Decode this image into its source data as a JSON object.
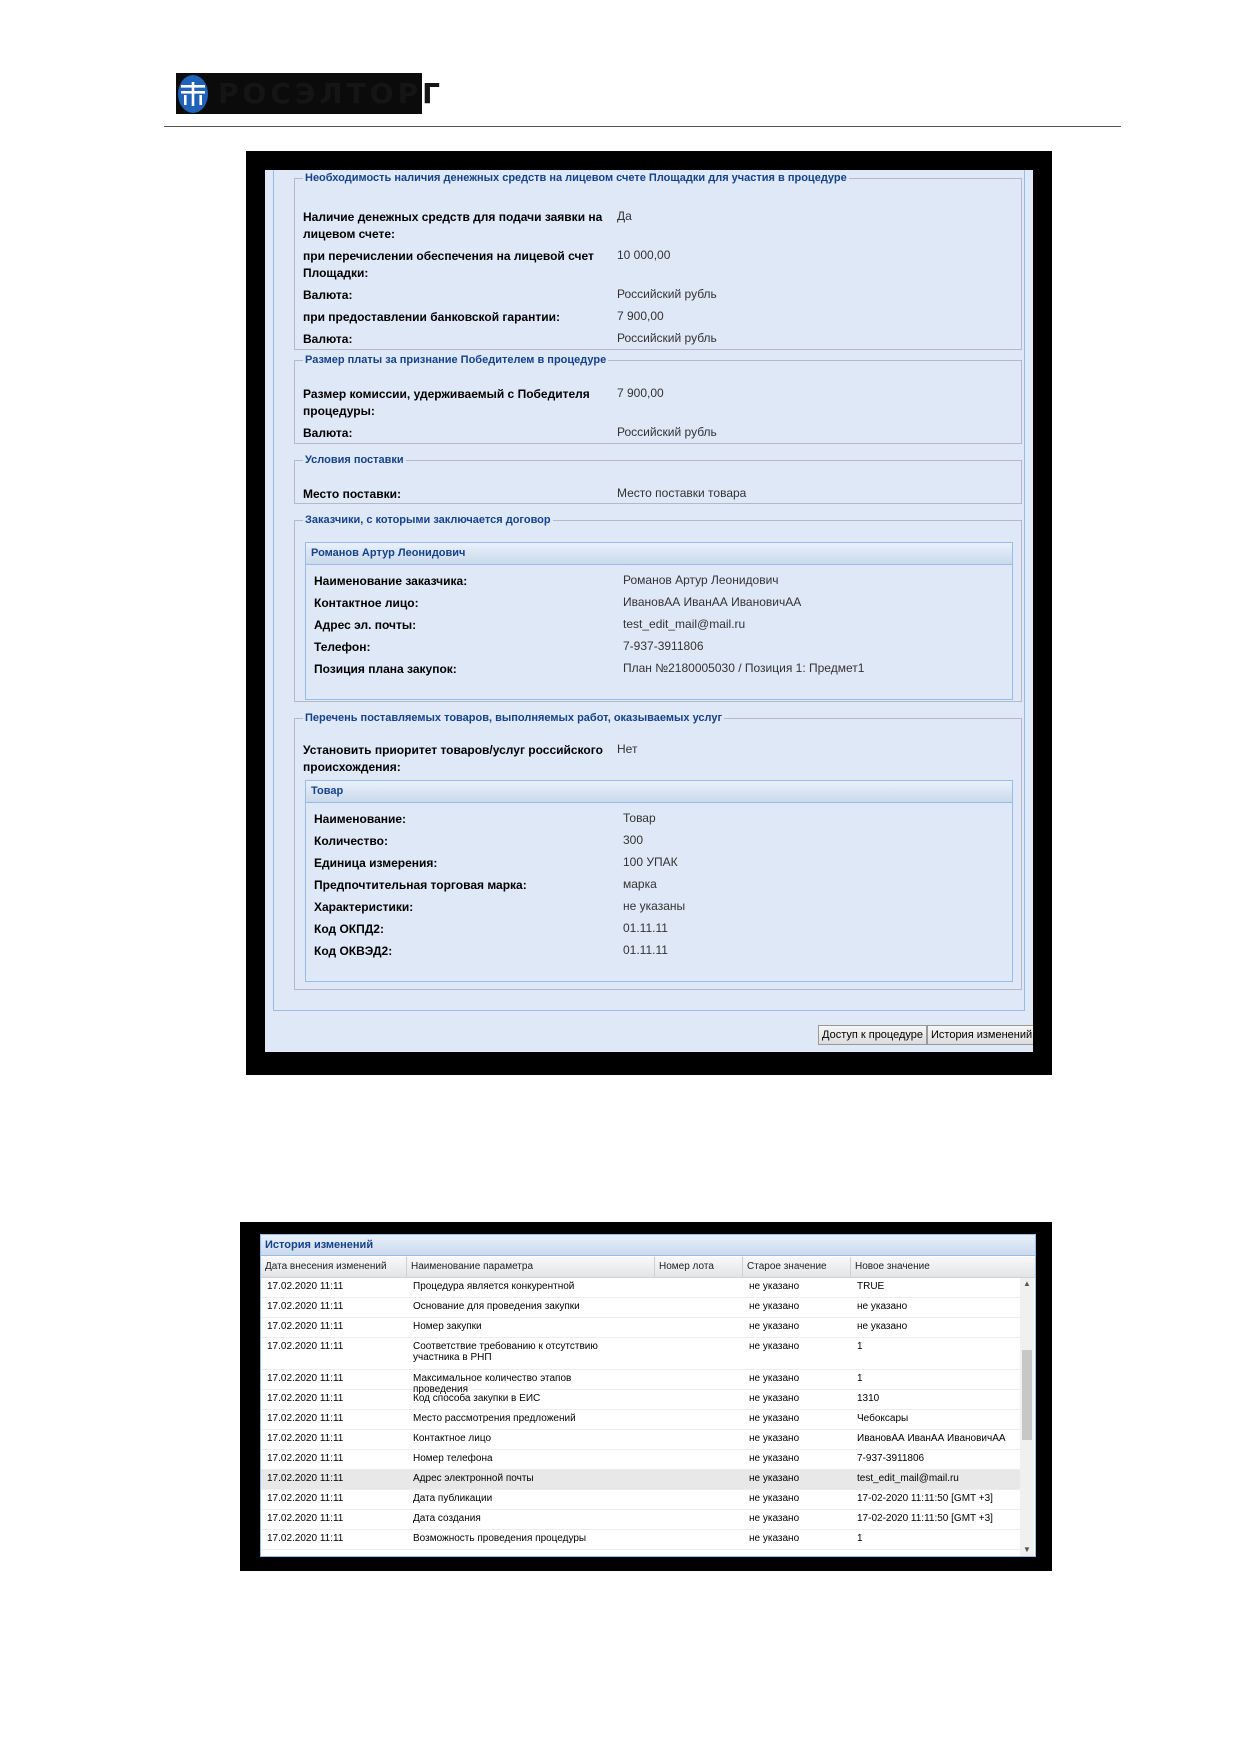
{
  "brand": {
    "logo_text": "РОСЭЛТОРГ"
  },
  "form": {
    "cash": {
      "legend": "Необходимость наличия денежных средств на лицевом счете Площадки для участия в процедуре",
      "rows": [
        {
          "label": "Наличие денежных средств для подачи заявки на лицевом счете:",
          "value": "Да"
        },
        {
          "label": "при перечислении обеспечения на лицевой счет Площадки:",
          "value": "10 000,00"
        },
        {
          "label": "Валюта:",
          "value": "Российский рубль"
        },
        {
          "label": "при предоставлении банковской гарантии:",
          "value": "7 900,00"
        },
        {
          "label": "Валюта:",
          "value": "Российский рубль"
        }
      ]
    },
    "fee": {
      "legend": "Размер платы за признание Победителем в процедуре",
      "rows": [
        {
          "label": "Размер комиссии, удерживаемый с Победителя процедуры:",
          "value": "7 900,00"
        },
        {
          "label": "Валюта:",
          "value": "Российский рубль"
        }
      ]
    },
    "delivery": {
      "legend": "Условия поставки",
      "rows": [
        {
          "label": "Место поставки:",
          "value": "Место поставки товара"
        }
      ]
    },
    "customers": {
      "legend": "Заказчики, с которыми заключается договор",
      "panel_title": "Романов Артур Леонидович",
      "rows": [
        {
          "label": "Наименование заказчика:",
          "value": "Романов Артур Леонидович"
        },
        {
          "label": "Контактное лицо:",
          "value": "ИвановАА ИванАА ИвановичАА"
        },
        {
          "label": "Адрес эл. почты:",
          "value": "test_edit_mail@mail.ru"
        },
        {
          "label": "Телефон:",
          "value": "7-937-3911806"
        },
        {
          "label": "Позиция плана закупок:",
          "value": "План №2180005030 / Позиция 1: Предмет1"
        }
      ]
    },
    "goods": {
      "legend": "Перечень поставляемых товаров, выполняемых работ, оказываемых услуг",
      "priority": {
        "label": "Установить приоритет товаров/услуг российского происхождения:",
        "value": "Нет"
      },
      "panel_title": "Товар",
      "rows": [
        {
          "label": "Наименование:",
          "value": "Товар"
        },
        {
          "label": "Количество:",
          "value": "300"
        },
        {
          "label": "Единица измерения:",
          "value": "100 УПАК"
        },
        {
          "label": "Предпочтительная торговая марка:",
          "value": "марка"
        },
        {
          "label": "Характеристики:",
          "value": "не указаны"
        },
        {
          "label": "Код ОКПД2:",
          "value": "01.11.11"
        },
        {
          "label": "Код ОКВЭД2:",
          "value": "01.11.11"
        }
      ]
    },
    "buttons": {
      "access": "Доступ к процедуре",
      "history": "История изменений"
    }
  },
  "history": {
    "title": "История изменений",
    "columns": [
      "Дата внесения изменений",
      "Наименование параметра",
      "Номер лота",
      "Старое значение",
      "Новое значение"
    ],
    "rows": [
      [
        "17.02.2020 11:11",
        "Процедура является конкурентной",
        "",
        "не указано",
        "TRUE"
      ],
      [
        "17.02.2020 11:11",
        "Основание для проведения закупки",
        "",
        "не указано",
        "не указано"
      ],
      [
        "17.02.2020 11:11",
        "Номер закупки",
        "",
        "не указано",
        "не указано"
      ],
      [
        "17.02.2020 11:11",
        "Соответствие требованию к отсутствию участника в РНП",
        "",
        "не указано",
        "1"
      ],
      [
        "17.02.2020 11:11",
        "Максимальное количество этапов проведения",
        "",
        "не указано",
        "1"
      ],
      [
        "17.02.2020 11:11",
        "Код способа закупки в ЕИС",
        "",
        "не указано",
        "1310"
      ],
      [
        "17.02.2020 11:11",
        "Место рассмотрения предложений",
        "",
        "не указано",
        "Чебоксары"
      ],
      [
        "17.02.2020 11:11",
        "Контактное лицо",
        "",
        "не указано",
        "ИвановАА ИванАА ИвановичАА"
      ],
      [
        "17.02.2020 11:11",
        "Номер телефона",
        "",
        "не указано",
        "7-937-3911806"
      ],
      [
        "17.02.2020 11:11",
        "Адрес электронной почты",
        "",
        "не указано",
        "test_edit_mail@mail.ru"
      ],
      [
        "17.02.2020 11:11",
        "Дата публикации",
        "",
        "не указано",
        "17-02-2020 11:11:50 [GMT +3]"
      ],
      [
        "17.02.2020 11:11",
        "Дата создания",
        "",
        "не указано",
        "17-02-2020 11:11:50 [GMT +3]"
      ],
      [
        "17.02.2020 11:11",
        "Возможность проведения процедуры",
        "",
        "не указано",
        "1"
      ]
    ],
    "selected_row": 9
  }
}
